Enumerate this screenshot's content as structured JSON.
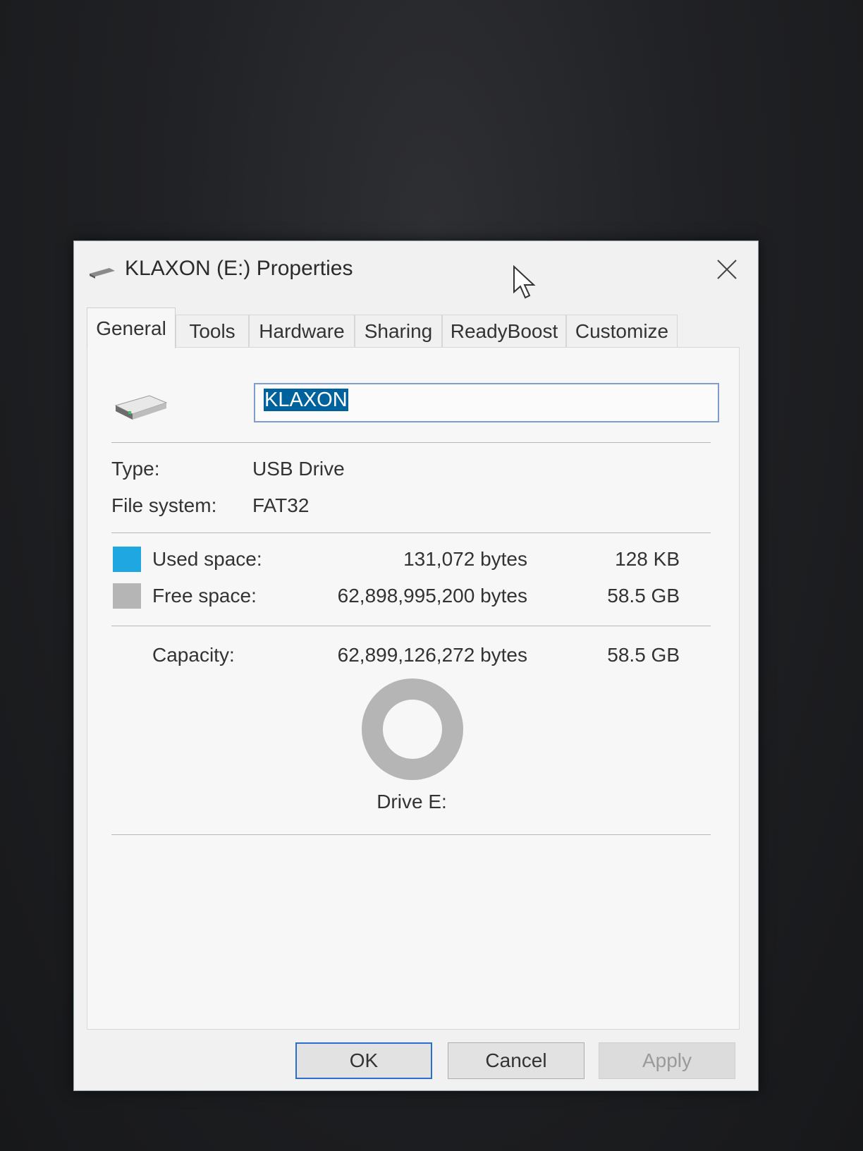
{
  "window": {
    "title": "KLAXON (E:) Properties"
  },
  "tabs": [
    {
      "label": "General",
      "active": true
    },
    {
      "label": "Tools",
      "active": false
    },
    {
      "label": "Hardware",
      "active": false
    },
    {
      "label": "Sharing",
      "active": false
    },
    {
      "label": "ReadyBoost",
      "active": false
    },
    {
      "label": "Customize",
      "active": false
    }
  ],
  "general": {
    "volume_name": "KLAXON",
    "type_label": "Type:",
    "type_value": "USB Drive",
    "fs_label": "File system:",
    "fs_value": "FAT32",
    "used_label": "Used space:",
    "used_bytes": "131,072 bytes",
    "used_size": "128 KB",
    "free_label": "Free space:",
    "free_bytes": "62,898,995,200 bytes",
    "free_size": "58.5 GB",
    "capacity_label": "Capacity:",
    "capacity_bytes": "62,899,126,272 bytes",
    "capacity_size": "58.5 GB",
    "drive_label": "Drive E:",
    "used_fraction": 2e-06
  },
  "colors": {
    "used": "#1ea7e1",
    "free": "#b5b5b5"
  },
  "buttons": {
    "ok": "OK",
    "cancel": "Cancel",
    "apply": "Apply"
  }
}
